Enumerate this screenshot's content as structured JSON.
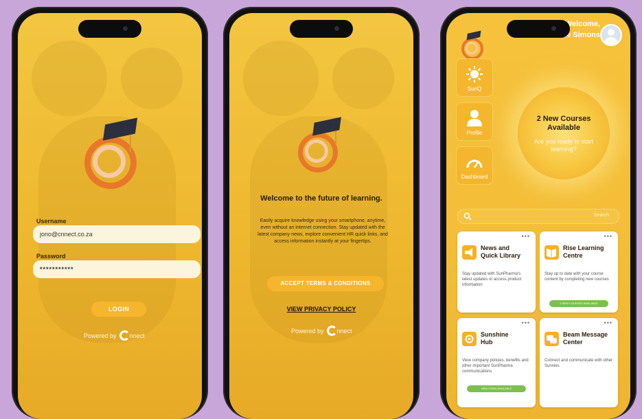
{
  "phone1": {
    "username_label": "Username",
    "username_value": "jono@cnnect.co.za",
    "password_label": "Password",
    "password_value": "***********",
    "login_label": "LOGIN",
    "powered_by": "Powered by",
    "brand": "nnect"
  },
  "phone2": {
    "welcome": "Welcome to the future of learning.",
    "paragraph": "Easily acquire knowledge using your smartphone, anytime, even without an internet connection. Stay updated with the latest company news, explore convenient HR quick links, and access information instantly at your fingertips.",
    "accept_label": "ACCEPT TERMS & CONDITIONS",
    "privacy_label": "VIEW PRIVACY POLICY",
    "powered_by": "Powered by",
    "brand": "nnect"
  },
  "phone3": {
    "welcome_line1": "Welcome,",
    "welcome_line2": "Tlale Simons",
    "side_items": [
      "SunQ",
      "Profile",
      "Dashboard"
    ],
    "sun_title": "2 New Courses Available",
    "sun_subtitle": "Are you ready to start learning?",
    "search_placeholder": "Search",
    "cards": [
      {
        "title_line1": "News and",
        "title_line2": "Quick Library",
        "desc": "Stay updated with SunPharma's latest updates or access product information",
        "bar": ""
      },
      {
        "title_line1": "Rise Learning",
        "title_line2": "Centre",
        "desc": "Stay up to date with your course content by completing new courses",
        "bar": "2 NEW COURSES AVAILABLE"
      },
      {
        "title_line1": "Sunshine",
        "title_line2": "Hub",
        "desc": "View company policies, benefits and other important SunPharma communications",
        "bar": "NEW ITEMS AVAILABLE"
      },
      {
        "title_line1": "Beam Message",
        "title_line2": "Center",
        "desc": "Connect and communicate with other Sunnies",
        "bar": ""
      }
    ],
    "card_menu": "•••"
  },
  "colors": {
    "background": "#c9a6d9",
    "screen_yellow": "#f0bd34",
    "accent_orange": "#e8772a",
    "cap_navy": "#2b2f3e",
    "bar_green": "#7cc04c"
  },
  "icons": [
    "graduation-cap-logo",
    "connect-logo",
    "sun-icon",
    "person-icon",
    "gauge-icon",
    "search-icon",
    "megaphone-icon",
    "book-icon",
    "sunshine-icon",
    "chat-icon",
    "avatar"
  ]
}
